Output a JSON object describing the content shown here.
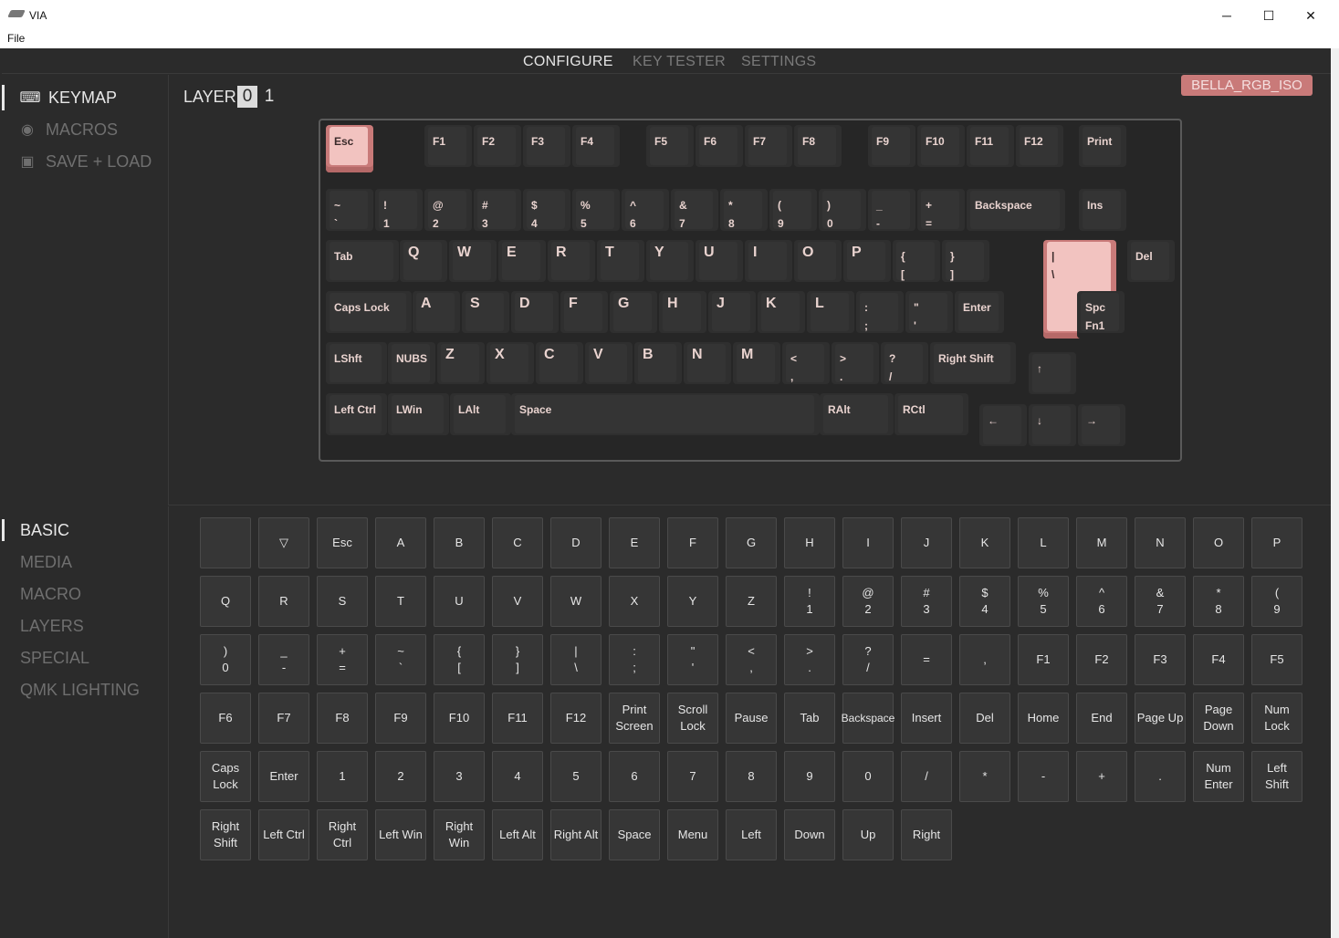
{
  "window": {
    "title": "VIA",
    "menu": "File",
    "controls": {
      "minimize": "─",
      "maximize": "☐",
      "close": "✕"
    }
  },
  "nav": {
    "tabs": [
      "CONFIGURE",
      "KEY TESTER",
      "SETTINGS"
    ],
    "active": "CONFIGURE"
  },
  "sidebar": {
    "items": [
      {
        "label": "KEYMAP",
        "icon": "keyboard-icon",
        "active": true
      },
      {
        "label": "MACROS",
        "icon": "record-icon",
        "active": false
      },
      {
        "label": "SAVE + LOAD",
        "icon": "save-icon",
        "active": false
      }
    ]
  },
  "layer": {
    "label": "LAYER",
    "layers": [
      "0",
      "1"
    ],
    "active": "0"
  },
  "keyboard_name": "BELLA_RGB_ISO",
  "accent_colors": {
    "key_active": "#f2c3c0",
    "key_active_rim": "#c97a79",
    "badge": "#c97a79"
  },
  "keymap": {
    "row0": [
      {
        "t": "Esc",
        "active": true
      },
      {
        "t": "F1"
      },
      {
        "t": "F2"
      },
      {
        "t": "F3"
      },
      {
        "t": "F4"
      },
      {
        "t": "F5"
      },
      {
        "t": "F6"
      },
      {
        "t": "F7"
      },
      {
        "t": "F8"
      },
      {
        "t": "F9"
      },
      {
        "t": "F10"
      },
      {
        "t": "F11"
      },
      {
        "t": "F12"
      },
      {
        "t": "Print"
      }
    ],
    "row1": [
      {
        "t": "~\n`"
      },
      {
        "t": "!\n1"
      },
      {
        "t": "@\n2"
      },
      {
        "t": "#\n3"
      },
      {
        "t": "$\n4"
      },
      {
        "t": "%\n5"
      },
      {
        "t": "^\n6"
      },
      {
        "t": "&\n7"
      },
      {
        "t": "*\n8"
      },
      {
        "t": "(\n9"
      },
      {
        "t": ")\n0"
      },
      {
        "t": "_\n-"
      },
      {
        "t": "+\n="
      },
      {
        "t": "Backspace"
      },
      {
        "t": "Ins"
      }
    ],
    "row2": [
      {
        "t": "Tab"
      },
      {
        "t": "Q",
        "big": true
      },
      {
        "t": "W",
        "big": true
      },
      {
        "t": "E",
        "big": true
      },
      {
        "t": "R",
        "big": true
      },
      {
        "t": "T",
        "big": true
      },
      {
        "t": "Y",
        "big": true
      },
      {
        "t": "U",
        "big": true
      },
      {
        "t": "I",
        "big": true
      },
      {
        "t": "O",
        "big": true
      },
      {
        "t": "P",
        "big": true
      },
      {
        "t": "{\n["
      },
      {
        "t": "}\n]"
      },
      {
        "t": "|\n\\",
        "active": true
      },
      {
        "t": "Del"
      }
    ],
    "row3": [
      {
        "t": "Caps Lock"
      },
      {
        "t": "A",
        "big": true
      },
      {
        "t": "S",
        "big": true
      },
      {
        "t": "D",
        "big": true
      },
      {
        "t": "F",
        "big": true
      },
      {
        "t": "G",
        "big": true
      },
      {
        "t": "H",
        "big": true
      },
      {
        "t": "J",
        "big": true
      },
      {
        "t": "K",
        "big": true
      },
      {
        "t": "L",
        "big": true
      },
      {
        "t": ":\n;"
      },
      {
        "t": "\"\n'"
      },
      {
        "t": "Enter"
      },
      {
        "t": "Spc\nFn1"
      }
    ],
    "row4": [
      {
        "t": "LShft"
      },
      {
        "t": "NUBS"
      },
      {
        "t": "Z",
        "big": true
      },
      {
        "t": "X",
        "big": true
      },
      {
        "t": "C",
        "big": true
      },
      {
        "t": "V",
        "big": true
      },
      {
        "t": "B",
        "big": true
      },
      {
        "t": "N",
        "big": true
      },
      {
        "t": "M",
        "big": true
      },
      {
        "t": "<\n,"
      },
      {
        "t": ">\n."
      },
      {
        "t": "?\n/"
      },
      {
        "t": "Right Shift"
      },
      {
        "t": "↑"
      }
    ],
    "row5": [
      {
        "t": "Left Ctrl"
      },
      {
        "t": "LWin"
      },
      {
        "t": "LAlt"
      },
      {
        "t": "Space"
      },
      {
        "t": "RAlt"
      },
      {
        "t": "RCtl"
      },
      {
        "t": "←"
      },
      {
        "t": "↓"
      },
      {
        "t": "→"
      }
    ]
  },
  "categories": [
    {
      "label": "BASIC",
      "active": true
    },
    {
      "label": "MEDIA"
    },
    {
      "label": "MACRO"
    },
    {
      "label": "LAYERS"
    },
    {
      "label": "SPECIAL"
    },
    {
      "label": "QMK LIGHTING"
    }
  ],
  "palette": [
    "",
    "▽",
    "Esc",
    "A",
    "B",
    "C",
    "D",
    "E",
    "F",
    "G",
    "H",
    "I",
    "J",
    "K",
    "L",
    "M",
    "N",
    "O",
    "P",
    "Q",
    "R",
    "S",
    "T",
    "U",
    "V",
    "W",
    "X",
    "Y",
    "Z",
    "!\n1",
    "@\n2",
    "#\n3",
    "$\n4",
    "%\n5",
    "^\n6",
    "&\n7",
    "*\n8",
    "(\n9",
    ")\n0",
    "_\n-",
    "+\n=",
    "~\n`",
    "{\n[",
    "}\n]",
    "|\n\\",
    ":\n;",
    "\"\n'",
    "<\n,",
    ">\n.",
    "?\n/",
    "=",
    ",",
    "F1",
    "F2",
    "F3",
    "F4",
    "F5",
    "F6",
    "F7",
    "F8",
    "F9",
    "F10",
    "F11",
    "F12",
    "Print\nScreen",
    "Scroll\nLock",
    "Pause",
    "Tab",
    "Backspace",
    "Insert",
    "Del",
    "Home",
    "End",
    "Page Up",
    "Page\nDown",
    "Num\nLock",
    "Caps\nLock",
    "Enter",
    "1",
    "2",
    "3",
    "4",
    "5",
    "6",
    "7",
    "8",
    "9",
    "0",
    "/",
    "*",
    "-",
    "+",
    ".",
    "Num\nEnter",
    "Left\nShift",
    "Right\nShift",
    "Left Ctrl",
    "Right\nCtrl",
    "Left Win",
    "Right\nWin",
    "Left Alt",
    "Right Alt",
    "Space",
    "Menu",
    "Left",
    "Down",
    "Up",
    "Right"
  ]
}
